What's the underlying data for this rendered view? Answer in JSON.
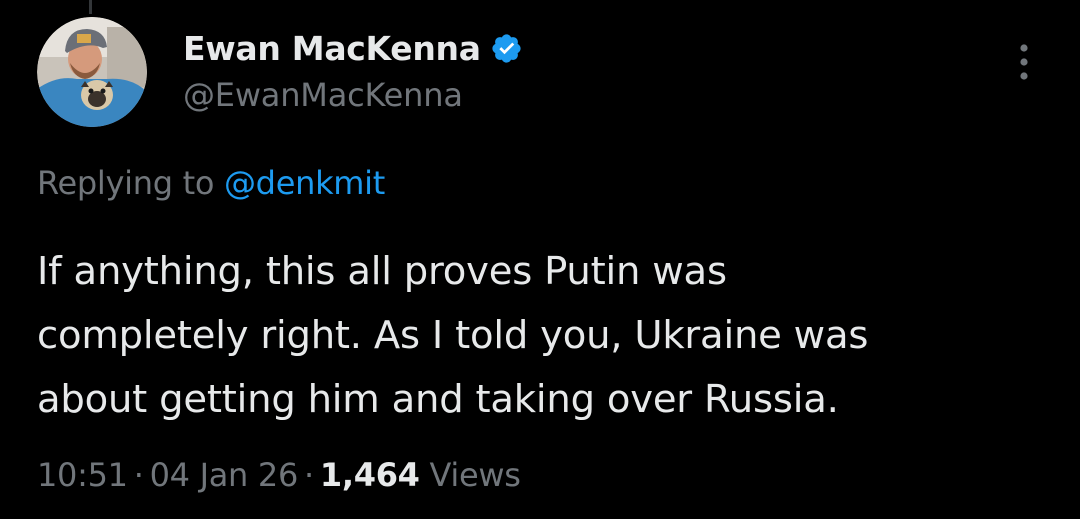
{
  "author": {
    "display_name": "Ewan MacKenna",
    "handle": "@EwanMacKenna",
    "verified_icon": "verified-badge-icon",
    "avatar_icon": "profile-photo"
  },
  "reply": {
    "prefix": "Replying to",
    "handle": "@denkmit"
  },
  "tweet": {
    "lines": [
      "If anything, this all proves Putin was",
      "completely right. As I told you, Ukraine was",
      "about getting him and taking over Russia."
    ]
  },
  "meta": {
    "time": "10:51",
    "date": "04 Jan 26",
    "separator": "·",
    "views_count": "1,464",
    "views_label": "Views"
  },
  "colors": {
    "background": "#000000",
    "primary_text": "#e7e9ea",
    "secondary_text": "#71767b",
    "accent": "#1d9bf0"
  },
  "more_icon": "more-options-icon"
}
